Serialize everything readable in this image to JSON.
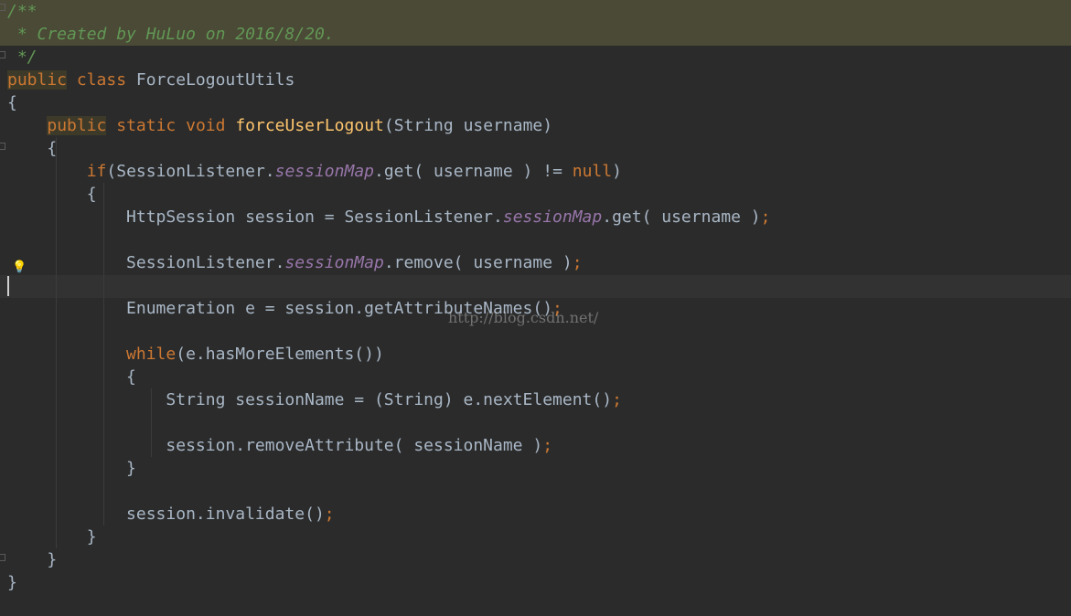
{
  "watermark": "http://blog.csdn.net/",
  "colors": {
    "background": "#2b2b2b",
    "doc_comment_highlight": "#4a4a36",
    "default": "#a9b7c6",
    "keyword": "#cc7832",
    "comment": "#629755",
    "function": "#ffc66d",
    "static_field": "#9876aa"
  },
  "icons": {
    "intention": "lightbulb-icon",
    "fold": "fold-marker-icon"
  },
  "lines": [
    {
      "tokens": [
        {
          "t": "/**",
          "c": "cm"
        }
      ]
    },
    {
      "tokens": [
        {
          "t": " * Created by HuLuo on 2016/8/20.",
          "c": "cm"
        }
      ]
    },
    {
      "tokens": [
        {
          "t": " */",
          "c": "cm"
        }
      ]
    },
    {
      "tokens": [
        {
          "t": "public",
          "c": "kw pub"
        },
        {
          "t": " "
        },
        {
          "t": "class",
          "c": "kw"
        },
        {
          "t": " ForceLogoutUtils"
        }
      ]
    },
    {
      "tokens": [
        {
          "t": "{"
        }
      ]
    },
    {
      "tokens": [
        {
          "t": "    "
        },
        {
          "t": "public",
          "c": "kw pub"
        },
        {
          "t": " "
        },
        {
          "t": "static",
          "c": "kw"
        },
        {
          "t": " "
        },
        {
          "t": "void",
          "c": "kw"
        },
        {
          "t": " "
        },
        {
          "t": "forceUserLogout",
          "c": "fn"
        },
        {
          "t": "(String username)"
        }
      ]
    },
    {
      "tokens": [
        {
          "t": "    {"
        }
      ]
    },
    {
      "tokens": [
        {
          "t": "        "
        },
        {
          "t": "if",
          "c": "kw"
        },
        {
          "t": "(SessionListener."
        },
        {
          "t": "sessionMap",
          "c": "fld"
        },
        {
          "t": ".get( username ) != "
        },
        {
          "t": "null",
          "c": "kw"
        },
        {
          "t": ")"
        }
      ]
    },
    {
      "tokens": [
        {
          "t": "        {"
        }
      ]
    },
    {
      "tokens": [
        {
          "t": "            HttpSession session = SessionListener."
        },
        {
          "t": "sessionMap",
          "c": "fld"
        },
        {
          "t": ".get( username )"
        },
        {
          "t": ";",
          "c": "kw"
        }
      ]
    },
    {
      "tokens": []
    },
    {
      "tokens": [
        {
          "t": "            SessionListener."
        },
        {
          "t": "sessionMap",
          "c": "fld"
        },
        {
          "t": ".remove( username )"
        },
        {
          "t": ";",
          "c": "kw"
        }
      ]
    },
    {
      "tokens": []
    },
    {
      "tokens": [
        {
          "t": "            Enumeration e = session.getAttributeNames()"
        },
        {
          "t": ";",
          "c": "kw"
        }
      ]
    },
    {
      "tokens": []
    },
    {
      "tokens": [
        {
          "t": "            "
        },
        {
          "t": "while",
          "c": "kw"
        },
        {
          "t": "(e.hasMoreElements())"
        }
      ]
    },
    {
      "tokens": [
        {
          "t": "            {"
        }
      ]
    },
    {
      "tokens": [
        {
          "t": "                String sessionName = (String) e.nextElement()"
        },
        {
          "t": ";",
          "c": "kw"
        }
      ]
    },
    {
      "tokens": []
    },
    {
      "tokens": [
        {
          "t": "                session.removeAttribute( sessionName )"
        },
        {
          "t": ";",
          "c": "kw"
        }
      ]
    },
    {
      "tokens": [
        {
          "t": "            }"
        }
      ]
    },
    {
      "tokens": []
    },
    {
      "tokens": [
        {
          "t": "            session.invalidate()"
        },
        {
          "t": ";",
          "c": "kw"
        }
      ]
    },
    {
      "tokens": [
        {
          "t": "        }"
        }
      ]
    },
    {
      "tokens": [
        {
          "t": "    }"
        }
      ]
    },
    {
      "tokens": [
        {
          "t": "}"
        }
      ]
    }
  ]
}
